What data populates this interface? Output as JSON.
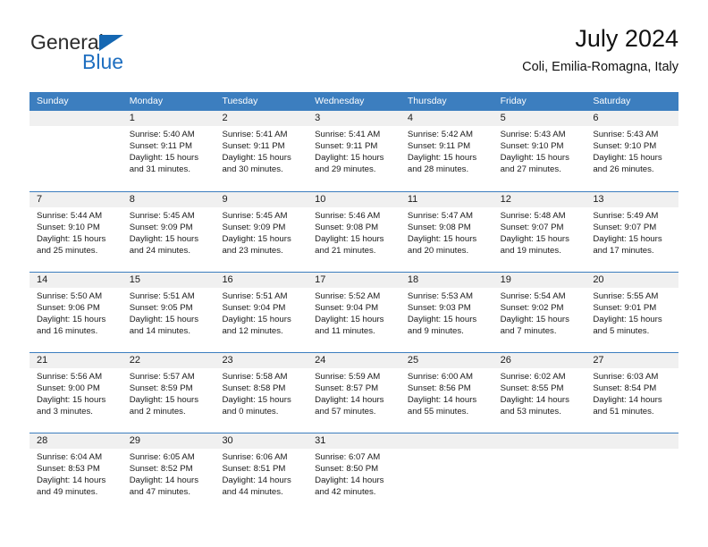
{
  "brand": {
    "name_top": "General",
    "name_bottom": "Blue",
    "triangle_color": "#1567b2",
    "blue_color": "#1f6fc0"
  },
  "header": {
    "title": "July 2024",
    "subtitle": "Coli, Emilia-Romagna, Italy"
  },
  "theme": {
    "header_blue": "#3c7ebf",
    "day_band_gray": "#f0f0f0",
    "text": "#1a1a1a"
  },
  "weekdays": [
    "Sunday",
    "Monday",
    "Tuesday",
    "Wednesday",
    "Thursday",
    "Friday",
    "Saturday"
  ],
  "weeks": [
    [
      {
        "day": "",
        "sunrise": "",
        "sunset": "",
        "daylight_line1": "",
        "daylight_line2": ""
      },
      {
        "day": "1",
        "sunrise": "Sunrise: 5:40 AM",
        "sunset": "Sunset: 9:11 PM",
        "daylight_line1": "Daylight: 15 hours",
        "daylight_line2": "and 31 minutes."
      },
      {
        "day": "2",
        "sunrise": "Sunrise: 5:41 AM",
        "sunset": "Sunset: 9:11 PM",
        "daylight_line1": "Daylight: 15 hours",
        "daylight_line2": "and 30 minutes."
      },
      {
        "day": "3",
        "sunrise": "Sunrise: 5:41 AM",
        "sunset": "Sunset: 9:11 PM",
        "daylight_line1": "Daylight: 15 hours",
        "daylight_line2": "and 29 minutes."
      },
      {
        "day": "4",
        "sunrise": "Sunrise: 5:42 AM",
        "sunset": "Sunset: 9:11 PM",
        "daylight_line1": "Daylight: 15 hours",
        "daylight_line2": "and 28 minutes."
      },
      {
        "day": "5",
        "sunrise": "Sunrise: 5:43 AM",
        "sunset": "Sunset: 9:10 PM",
        "daylight_line1": "Daylight: 15 hours",
        "daylight_line2": "and 27 minutes."
      },
      {
        "day": "6",
        "sunrise": "Sunrise: 5:43 AM",
        "sunset": "Sunset: 9:10 PM",
        "daylight_line1": "Daylight: 15 hours",
        "daylight_line2": "and 26 minutes."
      }
    ],
    [
      {
        "day": "7",
        "sunrise": "Sunrise: 5:44 AM",
        "sunset": "Sunset: 9:10 PM",
        "daylight_line1": "Daylight: 15 hours",
        "daylight_line2": "and 25 minutes."
      },
      {
        "day": "8",
        "sunrise": "Sunrise: 5:45 AM",
        "sunset": "Sunset: 9:09 PM",
        "daylight_line1": "Daylight: 15 hours",
        "daylight_line2": "and 24 minutes."
      },
      {
        "day": "9",
        "sunrise": "Sunrise: 5:45 AM",
        "sunset": "Sunset: 9:09 PM",
        "daylight_line1": "Daylight: 15 hours",
        "daylight_line2": "and 23 minutes."
      },
      {
        "day": "10",
        "sunrise": "Sunrise: 5:46 AM",
        "sunset": "Sunset: 9:08 PM",
        "daylight_line1": "Daylight: 15 hours",
        "daylight_line2": "and 21 minutes."
      },
      {
        "day": "11",
        "sunrise": "Sunrise: 5:47 AM",
        "sunset": "Sunset: 9:08 PM",
        "daylight_line1": "Daylight: 15 hours",
        "daylight_line2": "and 20 minutes."
      },
      {
        "day": "12",
        "sunrise": "Sunrise: 5:48 AM",
        "sunset": "Sunset: 9:07 PM",
        "daylight_line1": "Daylight: 15 hours",
        "daylight_line2": "and 19 minutes."
      },
      {
        "day": "13",
        "sunrise": "Sunrise: 5:49 AM",
        "sunset": "Sunset: 9:07 PM",
        "daylight_line1": "Daylight: 15 hours",
        "daylight_line2": "and 17 minutes."
      }
    ],
    [
      {
        "day": "14",
        "sunrise": "Sunrise: 5:50 AM",
        "sunset": "Sunset: 9:06 PM",
        "daylight_line1": "Daylight: 15 hours",
        "daylight_line2": "and 16 minutes."
      },
      {
        "day": "15",
        "sunrise": "Sunrise: 5:51 AM",
        "sunset": "Sunset: 9:05 PM",
        "daylight_line1": "Daylight: 15 hours",
        "daylight_line2": "and 14 minutes."
      },
      {
        "day": "16",
        "sunrise": "Sunrise: 5:51 AM",
        "sunset": "Sunset: 9:04 PM",
        "daylight_line1": "Daylight: 15 hours",
        "daylight_line2": "and 12 minutes."
      },
      {
        "day": "17",
        "sunrise": "Sunrise: 5:52 AM",
        "sunset": "Sunset: 9:04 PM",
        "daylight_line1": "Daylight: 15 hours",
        "daylight_line2": "and 11 minutes."
      },
      {
        "day": "18",
        "sunrise": "Sunrise: 5:53 AM",
        "sunset": "Sunset: 9:03 PM",
        "daylight_line1": "Daylight: 15 hours",
        "daylight_line2": "and 9 minutes."
      },
      {
        "day": "19",
        "sunrise": "Sunrise: 5:54 AM",
        "sunset": "Sunset: 9:02 PM",
        "daylight_line1": "Daylight: 15 hours",
        "daylight_line2": "and 7 minutes."
      },
      {
        "day": "20",
        "sunrise": "Sunrise: 5:55 AM",
        "sunset": "Sunset: 9:01 PM",
        "daylight_line1": "Daylight: 15 hours",
        "daylight_line2": "and 5 minutes."
      }
    ],
    [
      {
        "day": "21",
        "sunrise": "Sunrise: 5:56 AM",
        "sunset": "Sunset: 9:00 PM",
        "daylight_line1": "Daylight: 15 hours",
        "daylight_line2": "and 3 minutes."
      },
      {
        "day": "22",
        "sunrise": "Sunrise: 5:57 AM",
        "sunset": "Sunset: 8:59 PM",
        "daylight_line1": "Daylight: 15 hours",
        "daylight_line2": "and 2 minutes."
      },
      {
        "day": "23",
        "sunrise": "Sunrise: 5:58 AM",
        "sunset": "Sunset: 8:58 PM",
        "daylight_line1": "Daylight: 15 hours",
        "daylight_line2": "and 0 minutes."
      },
      {
        "day": "24",
        "sunrise": "Sunrise: 5:59 AM",
        "sunset": "Sunset: 8:57 PM",
        "daylight_line1": "Daylight: 14 hours",
        "daylight_line2": "and 57 minutes."
      },
      {
        "day": "25",
        "sunrise": "Sunrise: 6:00 AM",
        "sunset": "Sunset: 8:56 PM",
        "daylight_line1": "Daylight: 14 hours",
        "daylight_line2": "and 55 minutes."
      },
      {
        "day": "26",
        "sunrise": "Sunrise: 6:02 AM",
        "sunset": "Sunset: 8:55 PM",
        "daylight_line1": "Daylight: 14 hours",
        "daylight_line2": "and 53 minutes."
      },
      {
        "day": "27",
        "sunrise": "Sunrise: 6:03 AM",
        "sunset": "Sunset: 8:54 PM",
        "daylight_line1": "Daylight: 14 hours",
        "daylight_line2": "and 51 minutes."
      }
    ],
    [
      {
        "day": "28",
        "sunrise": "Sunrise: 6:04 AM",
        "sunset": "Sunset: 8:53 PM",
        "daylight_line1": "Daylight: 14 hours",
        "daylight_line2": "and 49 minutes."
      },
      {
        "day": "29",
        "sunrise": "Sunrise: 6:05 AM",
        "sunset": "Sunset: 8:52 PM",
        "daylight_line1": "Daylight: 14 hours",
        "daylight_line2": "and 47 minutes."
      },
      {
        "day": "30",
        "sunrise": "Sunrise: 6:06 AM",
        "sunset": "Sunset: 8:51 PM",
        "daylight_line1": "Daylight: 14 hours",
        "daylight_line2": "and 44 minutes."
      },
      {
        "day": "31",
        "sunrise": "Sunrise: 6:07 AM",
        "sunset": "Sunset: 8:50 PM",
        "daylight_line1": "Daylight: 14 hours",
        "daylight_line2": "and 42 minutes."
      },
      {
        "day": "",
        "sunrise": "",
        "sunset": "",
        "daylight_line1": "",
        "daylight_line2": ""
      },
      {
        "day": "",
        "sunrise": "",
        "sunset": "",
        "daylight_line1": "",
        "daylight_line2": ""
      },
      {
        "day": "",
        "sunrise": "",
        "sunset": "",
        "daylight_line1": "",
        "daylight_line2": ""
      }
    ]
  ]
}
